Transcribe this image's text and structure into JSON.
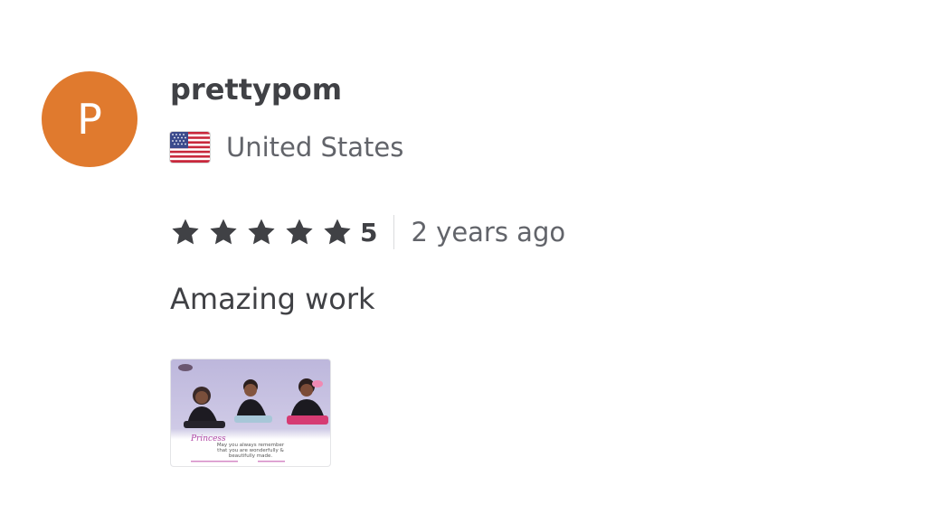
{
  "reviewer": {
    "avatar_letter": "P",
    "avatar_color": "#e07a2e",
    "username": "prettypom",
    "country": "United States",
    "flag_icon": "us-flag-icon"
  },
  "rating": {
    "stars": 5,
    "value": "5",
    "star_color": "#404145",
    "time_ago": "2 years ago"
  },
  "review": {
    "text": "Amazing work"
  },
  "attachment": {
    "thumbnail_text": [
      "Princess",
      "May you always remember",
      "that you are wonderfully &",
      "beautifully made."
    ]
  }
}
